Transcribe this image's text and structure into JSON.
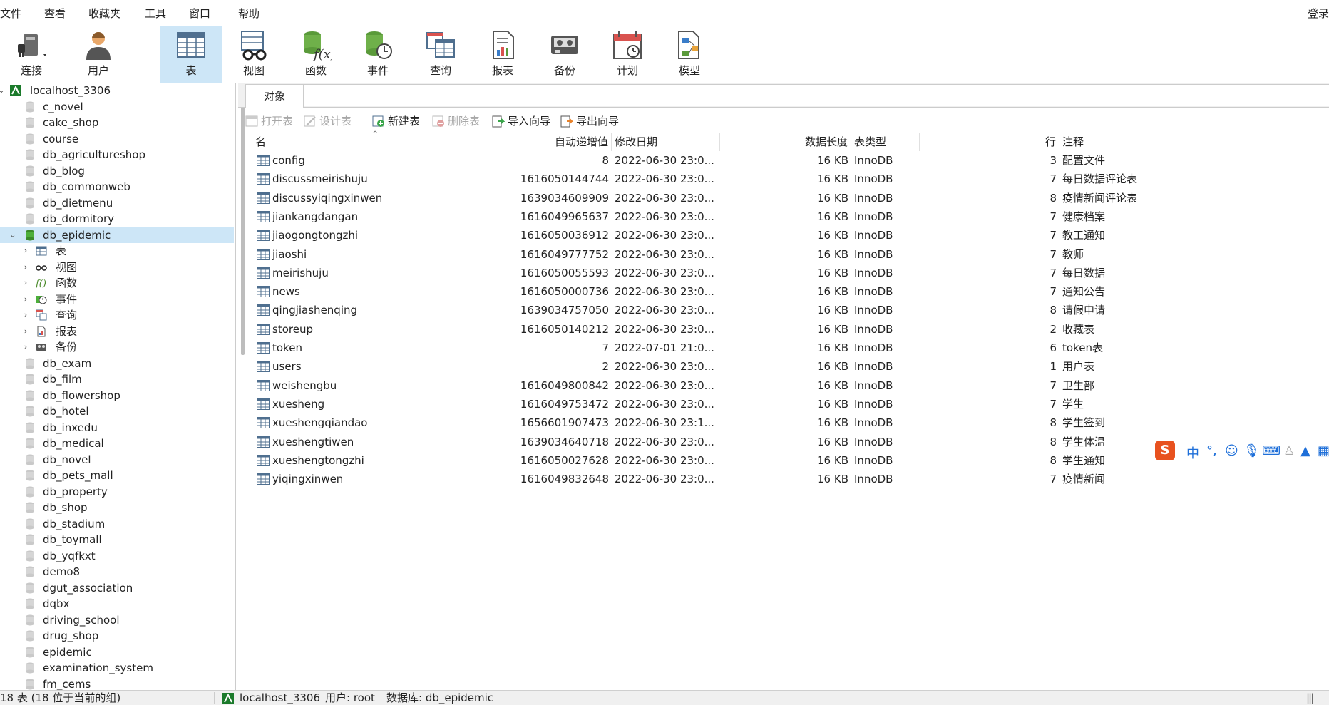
{
  "menu": [
    "文件",
    "查看",
    "收藏夹",
    "工具",
    "窗口",
    "帮助"
  ],
  "login_label": "登录",
  "toolbar": [
    {
      "label": "连接",
      "icon": "connection-plug-icon"
    },
    {
      "label": "用户",
      "icon": "user-icon"
    },
    {
      "label": "表",
      "icon": "table-icon",
      "active": true
    },
    {
      "label": "视图",
      "icon": "view-glasses-icon"
    },
    {
      "label": "函数",
      "icon": "function-icon"
    },
    {
      "label": "事件",
      "icon": "event-clock-icon"
    },
    {
      "label": "查询",
      "icon": "query-icon"
    },
    {
      "label": "报表",
      "icon": "report-icon"
    },
    {
      "label": "备份",
      "icon": "backup-icon"
    },
    {
      "label": "计划",
      "icon": "schedule-calendar-icon"
    },
    {
      "label": "模型",
      "icon": "model-icon"
    }
  ],
  "tree": {
    "connection": "localhost_3306",
    "databases_before": [
      "c_novel",
      "cake_shop",
      "course",
      "db_agricultureshop",
      "db_blog",
      "db_commonweb",
      "db_dietmenu",
      "db_dormitory"
    ],
    "selected_db": "db_epidemic",
    "children": [
      {
        "label": "表",
        "icon": "table-icon"
      },
      {
        "label": "视图",
        "icon": "view-glasses-icon"
      },
      {
        "label": "函数",
        "icon": "function-icon"
      },
      {
        "label": "事件",
        "icon": "event-clock-icon"
      },
      {
        "label": "查询",
        "icon": "query-icon"
      },
      {
        "label": "报表",
        "icon": "report-icon"
      },
      {
        "label": "备份",
        "icon": "backup-icon"
      }
    ],
    "databases_after": [
      "db_exam",
      "db_film",
      "db_flowershop",
      "db_hotel",
      "db_inxedu",
      "db_medical",
      "db_novel",
      "db_pets_mall",
      "db_property",
      "db_shop",
      "db_stadium",
      "db_toymall",
      "db_yqfkxt",
      "demo8",
      "dgut_association",
      "dqbx",
      "driving_school",
      "drug_shop",
      "epidemic",
      "examination_system",
      "fm_cems"
    ]
  },
  "tab_label": "对象",
  "obj_tools": [
    {
      "label": "打开表",
      "icon": "open-table-icon",
      "enabled": false
    },
    {
      "label": "设计表",
      "icon": "design-table-icon",
      "enabled": false
    },
    {
      "label": "新建表",
      "icon": "new-table-icon",
      "enabled": true
    },
    {
      "label": "删除表",
      "icon": "delete-table-icon",
      "enabled": false
    },
    {
      "label": "导入向导",
      "icon": "import-wizard-icon",
      "enabled": true
    },
    {
      "label": "导出向导",
      "icon": "export-wizard-icon",
      "enabled": true
    }
  ],
  "columns": [
    "名",
    "自动递增值",
    "修改日期",
    "数据长度",
    "表类型",
    "行",
    "注释"
  ],
  "rows": [
    [
      "config",
      "8",
      "2022-06-30 23:0...",
      "16 KB",
      "InnoDB",
      "3",
      "配置文件"
    ],
    [
      "discussmeirishuju",
      "1616050144744",
      "2022-06-30 23:0...",
      "16 KB",
      "InnoDB",
      "7",
      "每日数据评论表"
    ],
    [
      "discussyiqingxinwen",
      "1639034609909",
      "2022-06-30 23:0...",
      "16 KB",
      "InnoDB",
      "8",
      "疫情新闻评论表"
    ],
    [
      "jiankangdangan",
      "1616049965637",
      "2022-06-30 23:0...",
      "16 KB",
      "InnoDB",
      "7",
      "健康档案"
    ],
    [
      "jiaogongtongzhi",
      "1616050036912",
      "2022-06-30 23:0...",
      "16 KB",
      "InnoDB",
      "7",
      "教工通知"
    ],
    [
      "jiaoshi",
      "1616049777752",
      "2022-06-30 23:0...",
      "16 KB",
      "InnoDB",
      "7",
      "教师"
    ],
    [
      "meirishuju",
      "1616050055593",
      "2022-06-30 23:0...",
      "16 KB",
      "InnoDB",
      "7",
      "每日数据"
    ],
    [
      "news",
      "1616050000736",
      "2022-06-30 23:0...",
      "16 KB",
      "InnoDB",
      "7",
      "通知公告"
    ],
    [
      "qingjiashenqing",
      "1639034757050",
      "2022-06-30 23:0...",
      "16 KB",
      "InnoDB",
      "8",
      "请假申请"
    ],
    [
      "storeup",
      "1616050140212",
      "2022-06-30 23:0...",
      "16 KB",
      "InnoDB",
      "2",
      "收藏表"
    ],
    [
      "token",
      "7",
      "2022-07-01 21:0...",
      "16 KB",
      "InnoDB",
      "6",
      "token表"
    ],
    [
      "users",
      "2",
      "2022-06-30 23:0...",
      "16 KB",
      "InnoDB",
      "1",
      "用户表"
    ],
    [
      "weishengbu",
      "1616049800842",
      "2022-06-30 23:0...",
      "16 KB",
      "InnoDB",
      "7",
      "卫生部"
    ],
    [
      "xuesheng",
      "1616049753472",
      "2022-06-30 23:0...",
      "16 KB",
      "InnoDB",
      "7",
      "学生"
    ],
    [
      "xueshengqiandao",
      "1656601907473",
      "2022-06-30 23:1...",
      "16 KB",
      "InnoDB",
      "8",
      "学生签到"
    ],
    [
      "xueshengtiwen",
      "1639034640718",
      "2022-06-30 23:0...",
      "16 KB",
      "InnoDB",
      "8",
      "学生体温"
    ],
    [
      "xueshengtongzhi",
      "1616050027628",
      "2022-06-30 23:0...",
      "16 KB",
      "InnoDB",
      "8",
      "学生通知"
    ],
    [
      "yiqingxinwen",
      "1616049832648",
      "2022-06-30 23:0...",
      "16 KB",
      "InnoDB",
      "7",
      "疫情新闻"
    ]
  ],
  "status": {
    "left": "18 表 (18 位于当前的组)",
    "connection": "localhost_3306",
    "user": "用户: root",
    "database": "数据库: db_epidemic"
  },
  "ime_zh": "中"
}
